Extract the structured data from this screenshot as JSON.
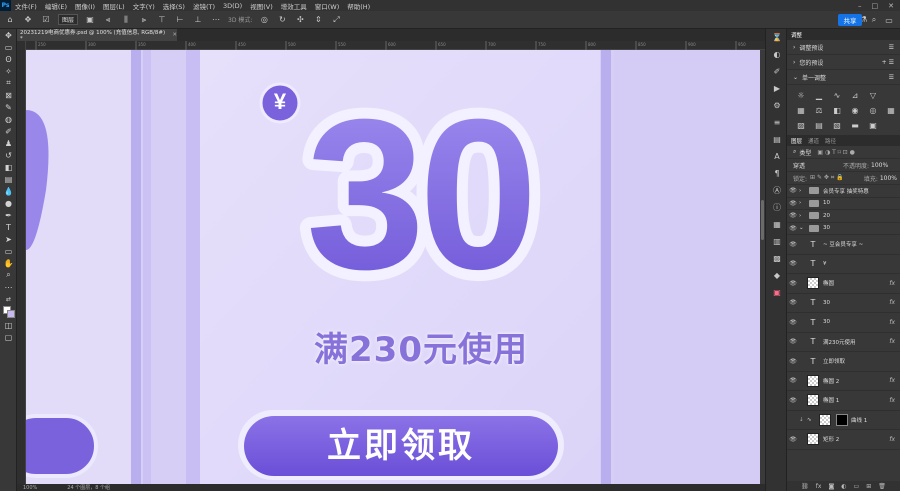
{
  "menubar": {
    "logo": "Ps",
    "items": [
      "文件(F)",
      "编辑(E)",
      "图像(I)",
      "图层(L)",
      "文字(Y)",
      "选择(S)",
      "滤镜(T)",
      "3D(D)",
      "视图(V)",
      "增效工具",
      "窗口(W)",
      "帮助(H)"
    ]
  },
  "options": {
    "auto_select": "图层",
    "mode_3d": "3D 模式:",
    "share": "共享"
  },
  "document": {
    "tab_title": "20231219电商优惠券.psd @ 100% (充值信息, RGB/8#) *",
    "zoom": "100%",
    "status": "24 个图层，8 个组"
  },
  "ruler_ticks": [
    "250",
    "300",
    "350",
    "400",
    "450",
    "500",
    "550",
    "600",
    "650",
    "700",
    "750",
    "800",
    "850",
    "900",
    "950"
  ],
  "canvas": {
    "currency": "¥",
    "amount": "30",
    "condition": "满230元使用",
    "button_label": "立即领取"
  },
  "adjustments_panel": {
    "tabs": [
      "调整"
    ],
    "rows": [
      "调整预设",
      "您的预设",
      "单一调整"
    ]
  },
  "layers_panel": {
    "tabs": [
      "图层",
      "通道",
      "路径"
    ],
    "filter_label": "类型",
    "blend_mode": "穿透",
    "opacity_label": "不透明度:",
    "opacity_value": "100%",
    "lock_label": "锁定:",
    "fill_label": "填充:",
    "fill_value": "100%",
    "groups": [
      "会员专享 抽奖特惠",
      "10",
      "20",
      "30"
    ],
    "layers": [
      {
        "name": "~ 豆会员专享 ~",
        "kind": "text",
        "fx": false
      },
      {
        "name": "¥",
        "kind": "text",
        "fx": false
      },
      {
        "name": "椭圆",
        "kind": "shape",
        "fx": true
      },
      {
        "name": "30",
        "kind": "text",
        "fx": true
      },
      {
        "name": "30",
        "kind": "text",
        "fx": true
      },
      {
        "name": "满230元使用",
        "kind": "text",
        "fx": true
      },
      {
        "name": "立即领取",
        "kind": "text",
        "fx": false
      },
      {
        "name": "椭圆 2",
        "kind": "shape",
        "fx": true
      },
      {
        "name": "椭圆 1",
        "kind": "shape",
        "fx": true
      },
      {
        "name": "曲线 1",
        "kind": "adjust",
        "fx": false
      },
      {
        "name": "矩形 2",
        "kind": "shape",
        "fx": true
      }
    ]
  },
  "colors": {
    "canvas_bg": "#d8d0f6",
    "accent_purple": "#7a62dd",
    "share_blue": "#1473e6"
  }
}
